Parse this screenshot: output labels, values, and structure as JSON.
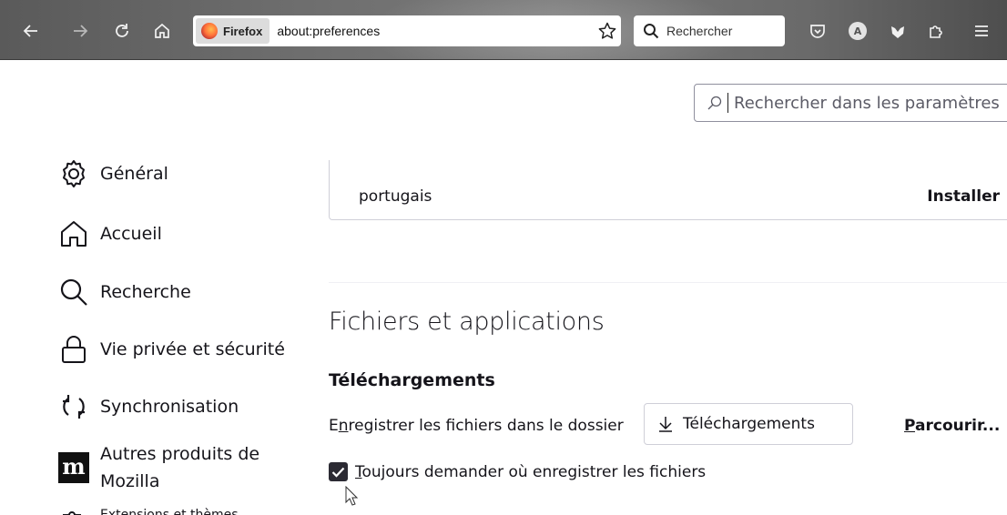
{
  "toolbar": {
    "identity_label": "Firefox",
    "url": "about:preferences",
    "search_placeholder": "Rechercher"
  },
  "prefs_search": {
    "placeholder": "Rechercher dans les paramètres"
  },
  "sidebar": {
    "items": [
      {
        "label": "Général",
        "icon": "gear-icon",
        "active": true
      },
      {
        "label": "Accueil",
        "icon": "home-icon"
      },
      {
        "label": "Recherche",
        "icon": "search-icon"
      },
      {
        "label": "Vie privée et sécurité",
        "icon": "lock-icon"
      },
      {
        "label": "Synchronisation",
        "icon": "sync-icon"
      },
      {
        "label_line1": "Autres produits de",
        "label_line2": "Mozilla",
        "icon": "mozilla-m-icon"
      },
      {
        "label": "Extensions et thèmes",
        "icon": "puzzle-icon"
      }
    ]
  },
  "languages": {
    "row_name": "portugais",
    "install_label": "Installer"
  },
  "files": {
    "section_title": "Fichiers et applications",
    "downloads_title": "Téléchargements",
    "save_label_pre": "E",
    "save_label_accel": "n",
    "save_label_post": "registrer les fichiers dans le dossier",
    "folder_name": "Téléchargements",
    "browse_accel": "P",
    "browse_rest": "arcourir...",
    "always_ask_accel": "T",
    "always_ask_rest": "oujours demander où enregistrer les fichiers",
    "always_ask_checked": true
  },
  "colors": {
    "accent_dark": "#2b2a33",
    "text": "#15141a",
    "border": "#cfcfd8"
  }
}
